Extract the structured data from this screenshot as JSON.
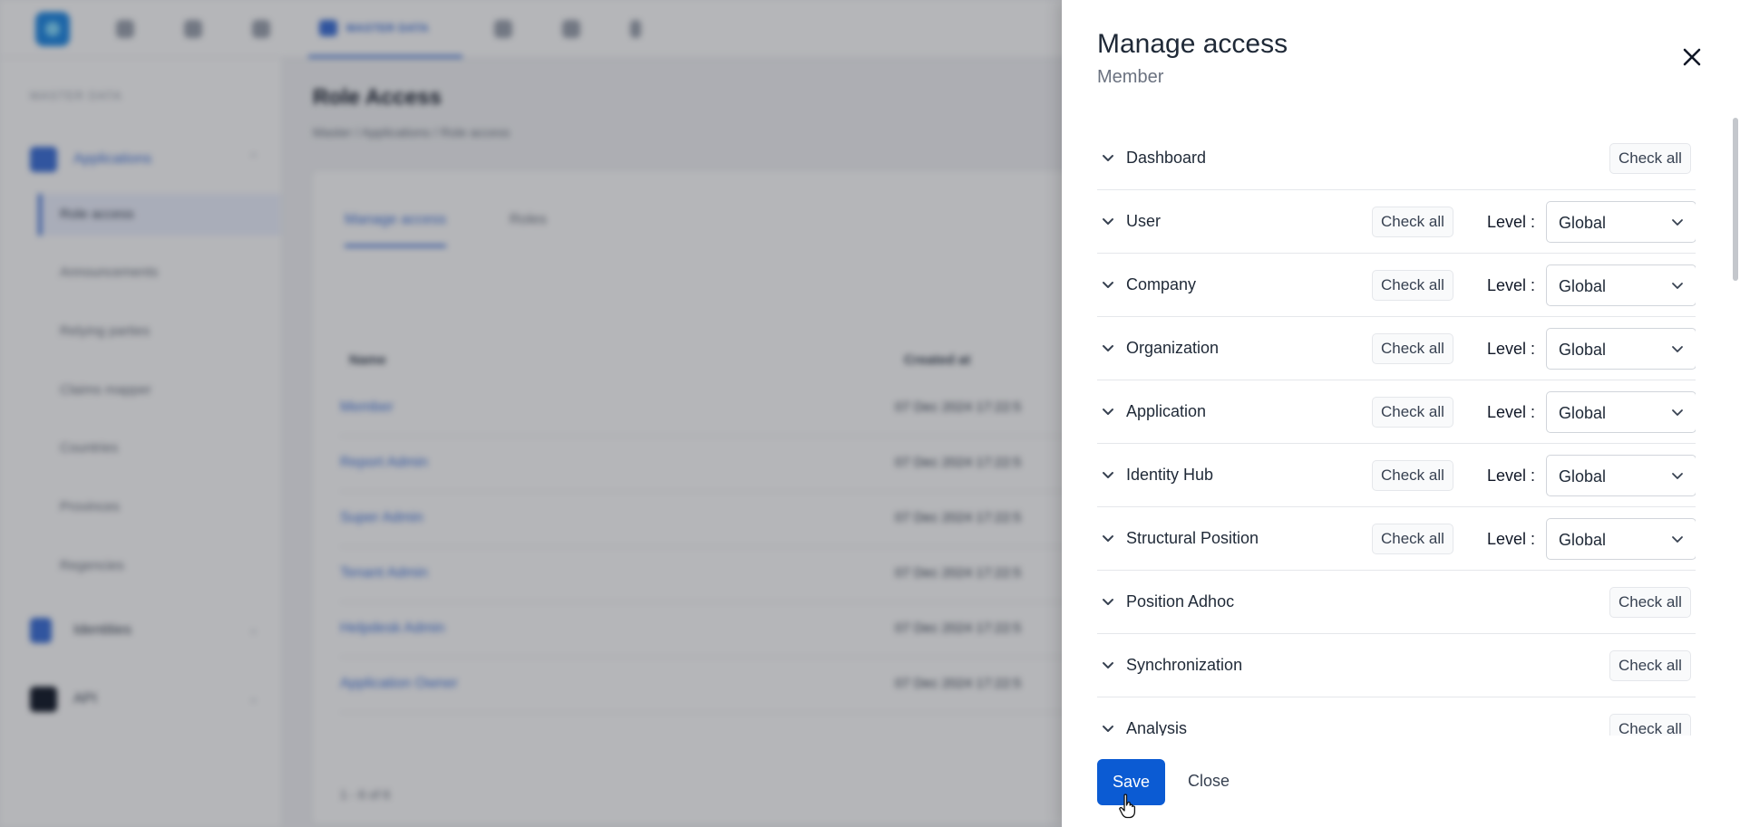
{
  "background": {
    "topbar": {
      "active_nav_label": "MASTER DATA"
    },
    "sidebar": {
      "caption": "MASTER DATA",
      "groups": [
        {
          "label": "Applications"
        },
        {
          "label": "Identities"
        },
        {
          "label": "API"
        }
      ],
      "sub_items": [
        "Role access",
        "Announcements",
        "Relying parties",
        "Claims mapper",
        "Countries",
        "Provinces",
        "Regencies"
      ]
    },
    "page": {
      "title": "Role Access",
      "breadcrumb": "Master  /  Applications  /  Role access",
      "tabs": [
        "Manage access",
        "Roles"
      ],
      "columns": [
        "Name",
        "Created at"
      ],
      "rows": [
        {
          "name": "Member",
          "created": "07 Dec 2024 17:22:5"
        },
        {
          "name": "Report Admin",
          "created": "07 Dec 2024 17:22:5"
        },
        {
          "name": "Super Admin",
          "created": "07 Dec 2024 17:22:5"
        },
        {
          "name": "Tenant Admin",
          "created": "07 Dec 2024 17:22:5"
        },
        {
          "name": "Helpdesk Admin",
          "created": "07 Dec 2024 17:22:5"
        },
        {
          "name": "Application Owner",
          "created": "07 Dec 2024 17:22:5"
        }
      ],
      "footer": "1 - 6 of 6"
    }
  },
  "drawer": {
    "title": "Manage access",
    "subtitle": "Member",
    "close_icon": "close-icon",
    "level_label": "Level :",
    "check_all_label": "Check all",
    "sections": [
      {
        "label": "Dashboard",
        "has_level": false
      },
      {
        "label": "User",
        "has_level": true,
        "level": "Global"
      },
      {
        "label": "Company",
        "has_level": true,
        "level": "Global"
      },
      {
        "label": "Organization",
        "has_level": true,
        "level": "Global"
      },
      {
        "label": "Application",
        "has_level": true,
        "level": "Global"
      },
      {
        "label": "Identity Hub",
        "has_level": true,
        "level": "Global"
      },
      {
        "label": "Structural Position",
        "has_level": true,
        "level": "Global"
      },
      {
        "label": "Position Adhoc",
        "has_level": false
      },
      {
        "label": "Synchronization",
        "has_level": false
      },
      {
        "label": "Analysis",
        "has_level": false
      }
    ],
    "save_label": "Save",
    "close_label": "Close"
  },
  "colors": {
    "primary": "#0b5bd3",
    "accent": "#3b6fd8"
  }
}
